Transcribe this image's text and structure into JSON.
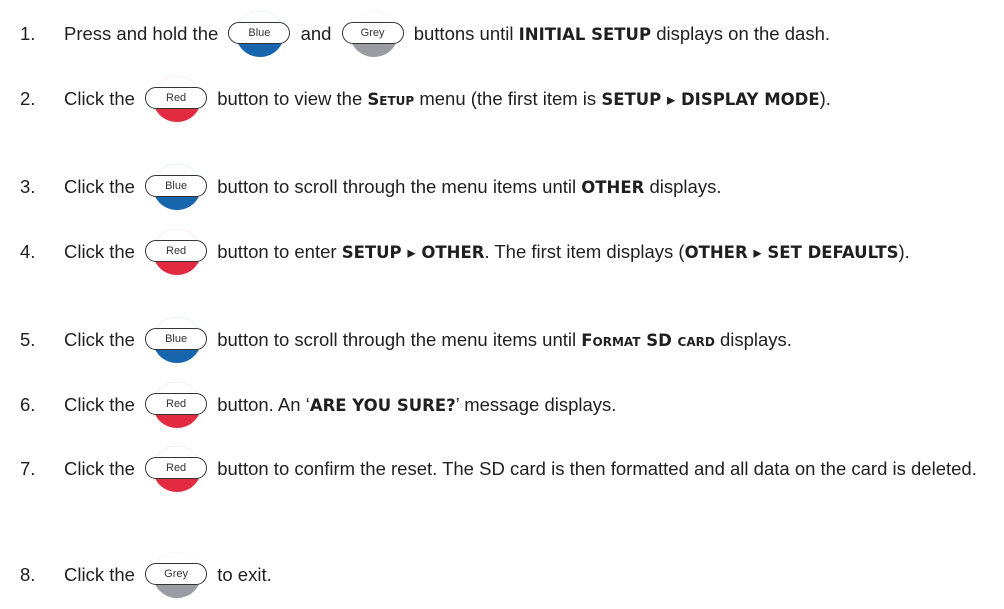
{
  "steps": [
    {
      "num": "1.",
      "t1": "Press and hold the",
      "btn1": "Blue",
      "t2": "and",
      "btn2": "Grey",
      "t3": "buttons until",
      "k1": "INITIAL SETUP",
      "t4": "displays on the dash."
    },
    {
      "num": "2.",
      "t1": "Click the",
      "btn1": "Red",
      "t2": "button to view the",
      "k1": "Setup",
      "t3": "menu (the first item is",
      "k2": "SETUP ▸ DISPLAY MODE",
      "t4": ")."
    },
    {
      "num": "3.",
      "t1": "Click the",
      "btn1": "Blue",
      "t2": "button to scroll through the menu items until",
      "k1": "OTHER",
      "t3": "displays."
    },
    {
      "num": "4.",
      "t1": "Click the",
      "btn1": "Red",
      "t2": "button to enter",
      "k1": "SETUP ▸ OTHER",
      "t3": ". The first item displays (",
      "k2": "OTHER ▸ SET DEFAULTS",
      "t4": ")."
    },
    {
      "num": "5.",
      "t1": "Click the",
      "btn1": "Blue",
      "t2": "button to scroll through the menu items until",
      "k1": "Format SD card",
      "t3": "displays."
    },
    {
      "num": "6.",
      "t1": "Click the",
      "btn1": "Red",
      "t2": "button. An ‘",
      "k1": "ARE YOU SURE?",
      "t3": "’ message displays."
    },
    {
      "num": "7.",
      "t1": "Click the",
      "btn1": "Red",
      "t2": "button to confirm the reset.  The SD card is then formatted and all data on the card is deleted."
    },
    {
      "num": "8.",
      "t1": "Click the",
      "btn1": "Grey",
      "t2": "to exit."
    }
  ],
  "colors": {
    "blue": "#1766ad",
    "red": "#e22a40",
    "grey": "#9a9ca1"
  }
}
